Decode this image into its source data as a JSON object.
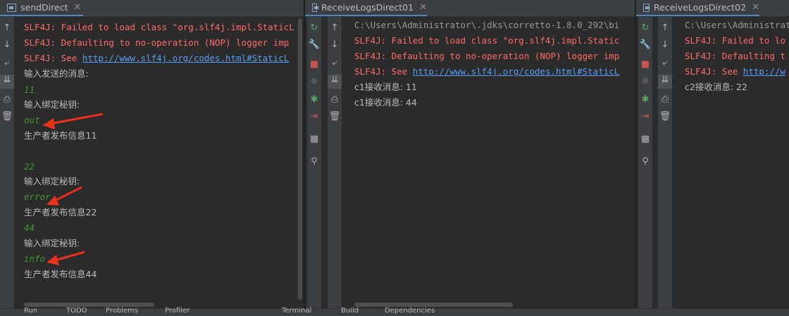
{
  "panels": [
    {
      "tab_title": "sendDirect",
      "lines": [
        {
          "text": "SLF4J: Failed to load class \"org.slf4j.impl.StaticL",
          "style": "red"
        },
        {
          "text": "SLF4J: Defaulting to no-operation (NOP) logger imp",
          "style": "red"
        },
        {
          "text_prefix": "SLF4J: See ",
          "link": "http://www.slf4j.org/codes.html#StaticL",
          "style": "red"
        },
        {
          "text": "输入发送的消息:",
          "style": "white"
        },
        {
          "text": "11",
          "style": "green"
        },
        {
          "text": "输入绑定秘钥:",
          "style": "white"
        },
        {
          "text": "out",
          "style": "green"
        },
        {
          "text": "生产者发布信息11",
          "style": "white"
        },
        {
          "text": "",
          "style": "white"
        },
        {
          "text": "22",
          "style": "green"
        },
        {
          "text": "输入绑定秘钥:",
          "style": "white"
        },
        {
          "text": "error",
          "style": "green"
        },
        {
          "text": "生产者发布信息22",
          "style": "white"
        },
        {
          "text": "44",
          "style": "green"
        },
        {
          "text": "输入绑定秘钥:",
          "style": "white"
        },
        {
          "text": "info",
          "style": "green"
        },
        {
          "text": "生产者发布信息44",
          "style": "white"
        }
      ],
      "tools": [
        "arrow-up-icon",
        "arrow-down-icon",
        "soft-wrap-icon",
        "scroll-to-end-icon",
        "print-icon",
        "trash-icon"
      ]
    },
    {
      "tab_title": "ReceiveLogsDirect01",
      "lines": [
        {
          "text": "C:\\Users\\Administrator\\.jdks\\corretto-1.8.0_292\\bi",
          "style": "gray"
        },
        {
          "text": "SLF4J: Failed to load class \"org.slf4j.impl.Static",
          "style": "red"
        },
        {
          "text": "SLF4J: Defaulting to no-operation (NOP) logger imp",
          "style": "red"
        },
        {
          "text_prefix": "SLF4J: See ",
          "link": "http://www.slf4j.org/codes.html#StaticL",
          "style": "red"
        },
        {
          "text": "c1接收消息: 11",
          "style": "white"
        },
        {
          "text": "c1接收消息: 44",
          "style": "white"
        }
      ],
      "tools": [
        "rerun-icon",
        "wrench-icon",
        "stop-icon",
        "camera-icon",
        "debug-icon",
        "exit-icon",
        "layout-icon",
        "pin-icon"
      ]
    },
    {
      "tab_title": "ReceiveLogsDirect02",
      "lines": [
        {
          "text": "C:\\Users\\Administrat",
          "style": "gray"
        },
        {
          "text": "SLF4J: Failed to lo",
          "style": "red"
        },
        {
          "text": "SLF4J: Defaulting t",
          "style": "red"
        },
        {
          "text_prefix": "SLF4J: See ",
          "link": "http://w",
          "style": "red"
        },
        {
          "text": "c2接收消息: 22",
          "style": "white"
        }
      ]
    }
  ],
  "status_bar": [
    "Run",
    "TODO",
    "Problems",
    "Profiler",
    "Terminal",
    "Build",
    "Dependencies"
  ],
  "colors": {
    "accent": "#4a88c7",
    "error": "#ff6b68",
    "input": "#3e9c2e",
    "annotation_arrow": "#e8321e"
  }
}
